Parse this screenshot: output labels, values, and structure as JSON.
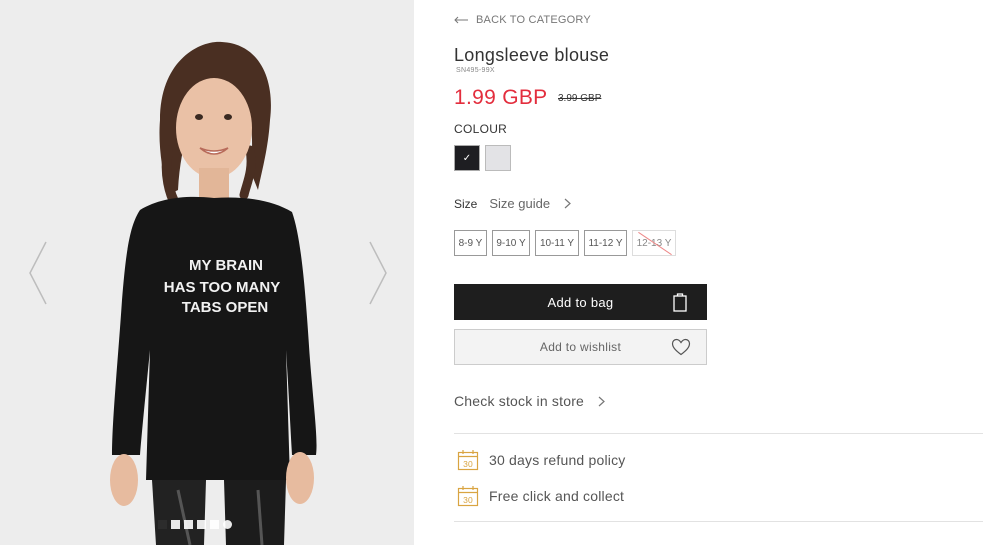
{
  "gallery": {
    "shirt_text": [
      "MY BRAIN",
      "HAS TOO MANY",
      "TABS OPEN"
    ],
    "dots": [
      "",
      "",
      "",
      "",
      "",
      ""
    ],
    "icons": {
      "prev": "chevron-left-icon",
      "next": "chevron-right-icon"
    }
  },
  "product": {
    "back_label": "BACK TO CATEGORY",
    "title": "Longsleeve blouse",
    "sku": "SN495-99X",
    "price": "1.99 GBP",
    "old_price": "3.99 GBP",
    "price_color": "#e32d3d",
    "colour_label": "COLOUR",
    "colours": [
      {
        "name": "black",
        "hex": "#1e1e22",
        "selected": true
      },
      {
        "name": "light-grey",
        "hex": "#e3e3e6",
        "selected": false
      }
    ],
    "size_label": "Size",
    "size_guide": "Size guide",
    "sizes": [
      {
        "label": "8-9 Y",
        "available": true
      },
      {
        "label": "9-10 Y",
        "available": true
      },
      {
        "label": "10-11 Y",
        "available": true
      },
      {
        "label": "11-12 Y",
        "available": true
      },
      {
        "label": "12-13 Y",
        "available": false
      }
    ],
    "add_to_bag": "Add to bag",
    "add_to_wishlist": "Add to wishlist",
    "check_stock": "Check stock in store",
    "perks": [
      {
        "label": "30 days refund policy",
        "icon": "calendar-30-icon",
        "icon_text": "30"
      },
      {
        "label": "Free click and collect",
        "icon": "calendar-30-icon",
        "icon_text": "30"
      }
    ],
    "perk_icon_color": "#d9a441"
  }
}
